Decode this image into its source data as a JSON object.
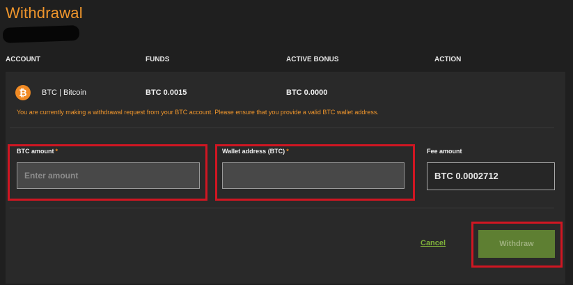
{
  "page": {
    "title": "Withdrawal"
  },
  "table": {
    "headers": [
      "ACCOUNT",
      "FUNDS",
      "ACTIVE BONUS",
      "ACTION"
    ],
    "row": {
      "currency_icon": "bitcoin-icon",
      "account": "BTC | Bitcoin",
      "funds": "BTC 0.0015",
      "active_bonus": "BTC 0.0000"
    },
    "notice": "You are currently making a withdrawal request from your BTC account. Please ensure that you provide a valid BTC wallet address."
  },
  "form": {
    "amount_label": "BTC amount",
    "amount_placeholder": "Enter amount",
    "amount_value": "",
    "wallet_label": "Wallet address (BTC)",
    "wallet_value": "",
    "required_mark": "*",
    "fee_label": "Fee amount",
    "fee_value": "BTC 0.0002712"
  },
  "actions": {
    "cancel_label": "Cancel",
    "withdraw_label": "Withdraw"
  },
  "colors": {
    "title": "#f0962c",
    "notice": "#f0962c",
    "highlight": "#d01622",
    "cancel_link": "#7fb13a",
    "withdraw_button": "#5e7f32",
    "bitcoin_icon": "#f08a24"
  }
}
